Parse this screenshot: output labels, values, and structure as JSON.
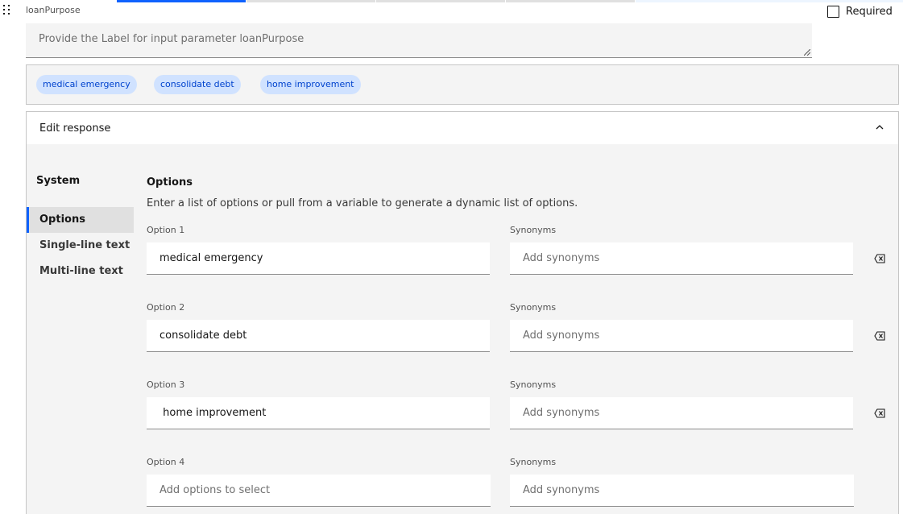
{
  "parameter": {
    "name": "loanPurpose",
    "required_label": "Required",
    "label_placeholder": "Provide the Label for input parameter loanPurpose"
  },
  "tags": [
    "medical emergency",
    "consolidate debt",
    "home improvement"
  ],
  "edit": {
    "title": "Edit response"
  },
  "sidebar": {
    "section": "System",
    "items": [
      {
        "label": "Options",
        "active": true
      },
      {
        "label": "Single-line text",
        "active": false
      },
      {
        "label": "Multi-line text",
        "active": false
      }
    ]
  },
  "options_panel": {
    "heading": "Options",
    "description": "Enter a list of options or pull from a variable to generate a dynamic list of options.",
    "rows": [
      {
        "option_label": "Option 1",
        "option_value": "medical emergency",
        "option_placeholder": "",
        "synonyms_label": "Synonyms",
        "synonyms_placeholder": "Add synonyms"
      },
      {
        "option_label": "Option 2",
        "option_value": "consolidate debt",
        "option_placeholder": "",
        "synonyms_label": "Synonyms",
        "synonyms_placeholder": "Add synonyms"
      },
      {
        "option_label": "Option 3",
        "option_value": " home improvement",
        "option_placeholder": "",
        "synonyms_label": "Synonyms",
        "synonyms_placeholder": "Add synonyms"
      },
      {
        "option_label": "Option 4",
        "option_value": "",
        "option_placeholder": "Add options to select",
        "synonyms_label": "Synonyms",
        "synonyms_placeholder": "Add synonyms"
      }
    ]
  },
  "colors": {
    "accent": "#0f62fe",
    "tag_bg": "#d0e2ff",
    "tag_text": "#0043ce",
    "panel_bg": "#f4f4f4"
  },
  "icons": {
    "drag": "drag-handle-icon",
    "chevron": "chevron-up-icon",
    "delete": "backspace-delete-icon"
  }
}
